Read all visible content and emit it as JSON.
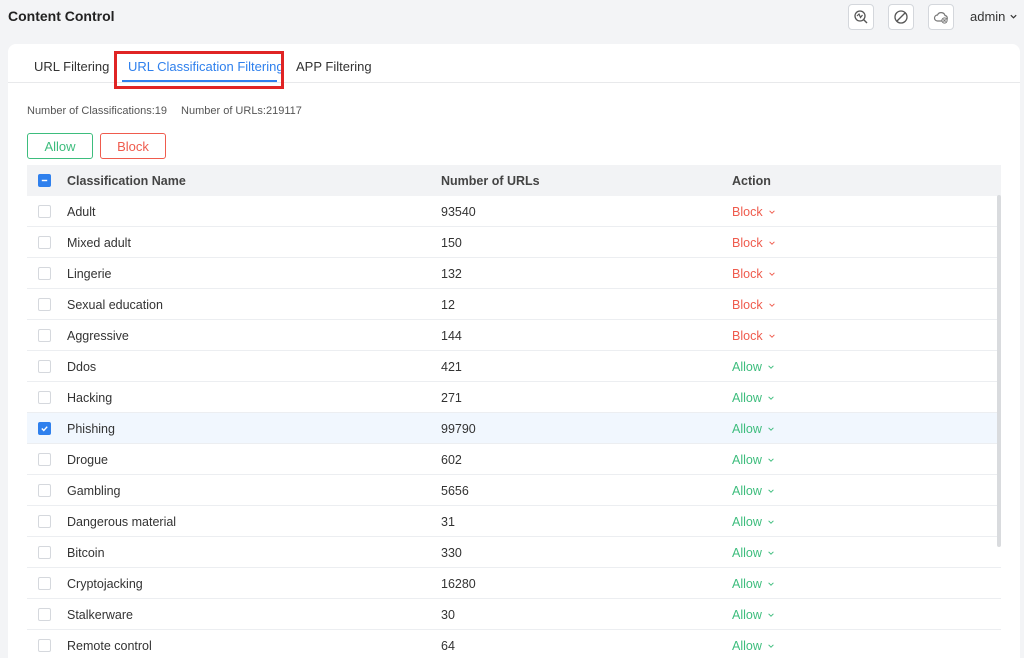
{
  "app": {
    "title": "Content Control",
    "user": "admin"
  },
  "tabs": [
    {
      "label": "URL Filtering",
      "active": false
    },
    {
      "label": "URL Classification Filtering",
      "active": true
    },
    {
      "label": "APP Filtering",
      "active": false
    }
  ],
  "stats": {
    "classifications": "Number of Classifications:19",
    "urls": "Number of URLs:219117"
  },
  "toolbar": {
    "allow_label": "Allow",
    "block_label": "Block"
  },
  "table": {
    "headers": {
      "name": "Classification Name",
      "count": "Number of URLs",
      "action": "Action"
    },
    "rows": [
      {
        "name": "Adult",
        "count": "93540",
        "action": "Block",
        "checked": false
      },
      {
        "name": "Mixed adult",
        "count": "150",
        "action": "Block",
        "checked": false
      },
      {
        "name": "Lingerie",
        "count": "132",
        "action": "Block",
        "checked": false
      },
      {
        "name": "Sexual education",
        "count": "12",
        "action": "Block",
        "checked": false
      },
      {
        "name": "Aggressive",
        "count": "144",
        "action": "Block",
        "checked": false
      },
      {
        "name": "Ddos",
        "count": "421",
        "action": "Allow",
        "checked": false
      },
      {
        "name": "Hacking",
        "count": "271",
        "action": "Allow",
        "checked": false
      },
      {
        "name": "Phishing",
        "count": "99790",
        "action": "Allow",
        "checked": true
      },
      {
        "name": "Drogue",
        "count": "602",
        "action": "Allow",
        "checked": false
      },
      {
        "name": "Gambling",
        "count": "5656",
        "action": "Allow",
        "checked": false
      },
      {
        "name": "Dangerous material",
        "count": "31",
        "action": "Allow",
        "checked": false
      },
      {
        "name": "Bitcoin",
        "count": "330",
        "action": "Allow",
        "checked": false
      },
      {
        "name": "Cryptojacking",
        "count": "16280",
        "action": "Allow",
        "checked": false
      },
      {
        "name": "Stalkerware",
        "count": "30",
        "action": "Allow",
        "checked": false
      },
      {
        "name": "Remote control",
        "count": "64",
        "action": "Allow",
        "checked": false
      }
    ]
  },
  "colors": {
    "accent": "#2f80ed",
    "allow": "#3dbd7d",
    "block": "#ef5b4d",
    "highlight": "#e02424"
  },
  "icons": {
    "topbar": [
      "diagnostics-icon",
      "block-circle-icon",
      "cloud-icon"
    ],
    "chevron": "chevron-down-icon"
  }
}
